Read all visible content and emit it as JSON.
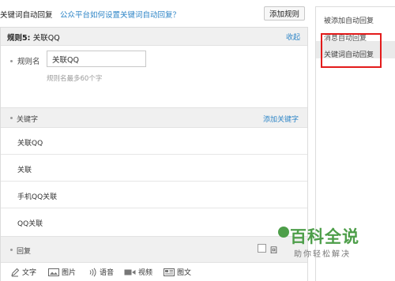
{
  "header": {
    "title": "关键词自动回复",
    "help_link": "公众平台如何设置关键词自动回复？",
    "add_rule_button": "添加规则"
  },
  "rule": {
    "title_prefix": "规则5:",
    "title_name": "关联QQ",
    "collapse_link": "收起",
    "name_label": "规则名",
    "name_value": "关联QQ",
    "name_hint": "规则名最多60个字",
    "keywords_label": "关键字",
    "add_keyword_link": "添加关键字",
    "keywords": [
      "关联QQ",
      "关联",
      "手机QQ关联",
      "QQ关联"
    ],
    "reply_label": "回复",
    "reply_checkbox_label": "回"
  },
  "toolbar": {
    "text": "文字",
    "image": "图片",
    "voice": "语音",
    "video": "视频",
    "news": "图文"
  },
  "sidebar": {
    "items": [
      "被添加自动回复",
      "消息自动回复",
      "关键词自动回复"
    ],
    "active_index": 2
  },
  "watermark": {
    "title": "百科全说",
    "subtitle": "助你轻松解决"
  },
  "colors": {
    "link": "#2f86c7",
    "highlight": "#e31b1b",
    "watermark": "#4d9e49"
  }
}
